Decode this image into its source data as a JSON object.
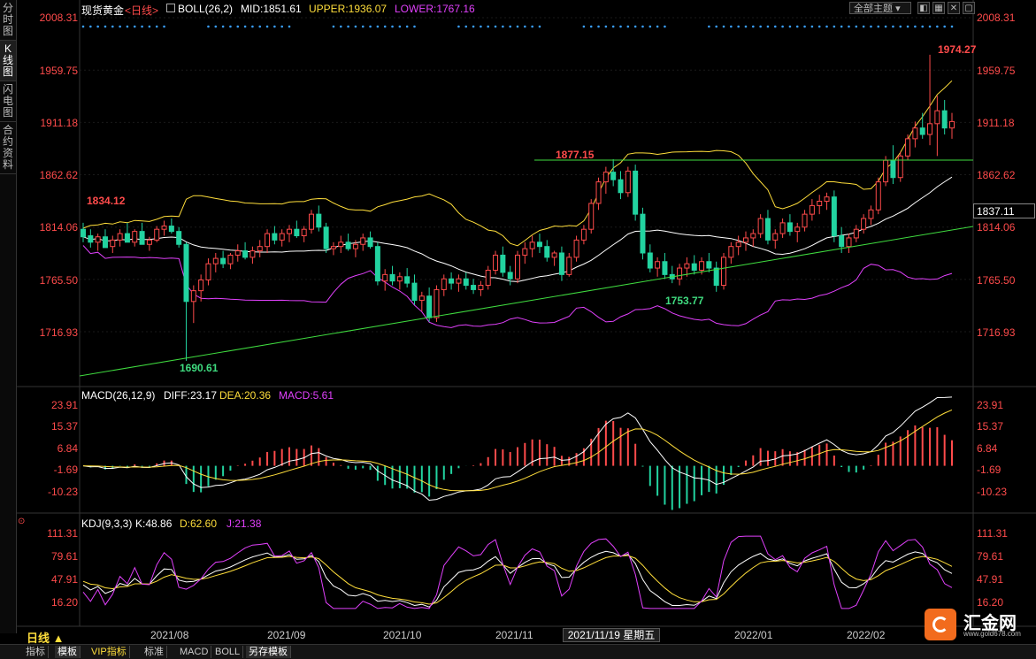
{
  "left_rail": [
    {
      "label": "分时图",
      "active": false
    },
    {
      "label": "K线图",
      "active": true
    },
    {
      "label": "闪电图",
      "active": false
    },
    {
      "label": "合约资料",
      "active": false
    }
  ],
  "header": {
    "symbol": "现货黄金",
    "period": "<日线>",
    "boll_label": "BOLL(26,2)",
    "mid": "MID:1851.61",
    "upper": "UPPER:1936.07",
    "lower": "LOWER:1767.16",
    "theme_select": "全部主题",
    "colors": {
      "symbol": "#ffffff",
      "period": "#ff4b4b",
      "mid": "#ffffff",
      "upper": "#ffde3b",
      "lower": "#e040fb"
    }
  },
  "price_axis": {
    "labels": [
      "2008.31",
      "1959.75",
      "1911.18",
      "1862.62",
      "1814.06",
      "1765.50",
      "1716.93"
    ],
    "current_price": "1837.11"
  },
  "annotations": {
    "high": "1974.27",
    "nov_high": "1877.15",
    "early_level": "1834.12",
    "low": "1690.61",
    "nov_low": "1753.77"
  },
  "macd": {
    "label": "MACD(26,12,9)",
    "diff": "DIFF:23.17",
    "dea": "DEA:20.36",
    "macd": "MACD:5.61",
    "axis": [
      "23.91",
      "15.37",
      "6.84",
      "-1.69",
      "-10.23"
    ]
  },
  "kdj": {
    "label": "KDJ(9,3,3)",
    "k": "K:48.86",
    "d": "D:62.60",
    "j": "J:21.38",
    "axis": [
      "111.31",
      "79.61",
      "47.91",
      "16.20"
    ]
  },
  "dates": [
    "2021/08",
    "2021/09",
    "2021/10",
    "2021/11",
    "2022/01",
    "2022/02"
  ],
  "crosshair_date": "2021/11/19 星期五",
  "period_button": "日线 ▲",
  "bottom_tabs": [
    {
      "label": "指标",
      "active": false
    },
    {
      "label": "模板",
      "active": true
    },
    {
      "label": "VIP指标",
      "active": false
    },
    {
      "label": "标准",
      "active": false
    },
    {
      "label": "MACD",
      "active": false
    },
    {
      "label": "BOLL",
      "active": false
    },
    {
      "label": "另存模板",
      "active": false
    }
  ],
  "logo": {
    "name": "汇金网",
    "url": "www.gold678.com"
  },
  "window_buttons": [
    "◧",
    "▦",
    "✕",
    "▢"
  ],
  "chart_data": {
    "type": "candlestick",
    "series_daily": [
      [
        1812,
        1818,
        1800,
        1805
      ],
      [
        1806,
        1812,
        1795,
        1800
      ],
      [
        1800,
        1808,
        1792,
        1805
      ],
      [
        1805,
        1812,
        1798,
        1795
      ],
      [
        1796,
        1806,
        1790,
        1802
      ],
      [
        1802,
        1812,
        1796,
        1808
      ],
      [
        1808,
        1818,
        1802,
        1800
      ],
      [
        1800,
        1812,
        1796,
        1810
      ],
      [
        1810,
        1818,
        1804,
        1798
      ],
      [
        1798,
        1805,
        1792,
        1802
      ],
      [
        1802,
        1815,
        1800,
        1812
      ],
      [
        1812,
        1820,
        1806,
        1815
      ],
      [
        1815,
        1822,
        1808,
        1810
      ],
      [
        1810,
        1814,
        1795,
        1798
      ],
      [
        1798,
        1800,
        1690,
        1745
      ],
      [
        1745,
        1760,
        1725,
        1755
      ],
      [
        1755,
        1770,
        1745,
        1765
      ],
      [
        1765,
        1785,
        1760,
        1780
      ],
      [
        1780,
        1790,
        1772,
        1785
      ],
      [
        1785,
        1792,
        1776,
        1780
      ],
      [
        1780,
        1790,
        1775,
        1788
      ],
      [
        1788,
        1798,
        1782,
        1792
      ],
      [
        1792,
        1800,
        1784,
        1786
      ],
      [
        1786,
        1796,
        1780,
        1792
      ],
      [
        1792,
        1802,
        1786,
        1796
      ],
      [
        1796,
        1812,
        1790,
        1808
      ],
      [
        1808,
        1815,
        1798,
        1802
      ],
      [
        1802,
        1812,
        1796,
        1808
      ],
      [
        1808,
        1816,
        1800,
        1812
      ],
      [
        1812,
        1820,
        1804,
        1806
      ],
      [
        1806,
        1815,
        1800,
        1812
      ],
      [
        1812,
        1830,
        1808,
        1826
      ],
      [
        1826,
        1834,
        1810,
        1814
      ],
      [
        1814,
        1818,
        1790,
        1794
      ],
      [
        1794,
        1800,
        1788,
        1796
      ],
      [
        1796,
        1806,
        1790,
        1800
      ],
      [
        1800,
        1808,
        1792,
        1794
      ],
      [
        1794,
        1802,
        1786,
        1798
      ],
      [
        1798,
        1808,
        1792,
        1804
      ],
      [
        1804,
        1810,
        1794,
        1796
      ],
      [
        1796,
        1800,
        1760,
        1764
      ],
      [
        1764,
        1775,
        1755,
        1770
      ],
      [
        1770,
        1778,
        1760,
        1764
      ],
      [
        1764,
        1772,
        1756,
        1768
      ],
      [
        1768,
        1776,
        1758,
        1762
      ],
      [
        1762,
        1770,
        1742,
        1746
      ],
      [
        1746,
        1754,
        1736,
        1750
      ],
      [
        1750,
        1758,
        1726,
        1730
      ],
      [
        1730,
        1760,
        1726,
        1756
      ],
      [
        1756,
        1770,
        1750,
        1766
      ],
      [
        1766,
        1772,
        1756,
        1762
      ],
      [
        1762,
        1770,
        1754,
        1766
      ],
      [
        1766,
        1772,
        1756,
        1760
      ],
      [
        1760,
        1766,
        1752,
        1756
      ],
      [
        1756,
        1764,
        1750,
        1760
      ],
      [
        1760,
        1778,
        1756,
        1774
      ],
      [
        1774,
        1792,
        1770,
        1788
      ],
      [
        1788,
        1796,
        1768,
        1772
      ],
      [
        1772,
        1778,
        1760,
        1766
      ],
      [
        1766,
        1792,
        1762,
        1788
      ],
      [
        1788,
        1800,
        1780,
        1794
      ],
      [
        1794,
        1806,
        1786,
        1800
      ],
      [
        1800,
        1808,
        1790,
        1796
      ],
      [
        1796,
        1802,
        1782,
        1786
      ],
      [
        1786,
        1792,
        1778,
        1790
      ],
      [
        1790,
        1796,
        1764,
        1770
      ],
      [
        1770,
        1790,
        1768,
        1786
      ],
      [
        1786,
        1806,
        1782,
        1802
      ],
      [
        1802,
        1816,
        1798,
        1812
      ],
      [
        1812,
        1840,
        1808,
        1836
      ],
      [
        1836,
        1860,
        1830,
        1856
      ],
      [
        1856,
        1870,
        1845,
        1865
      ],
      [
        1865,
        1877,
        1852,
        1858
      ],
      [
        1858,
        1866,
        1840,
        1846
      ],
      [
        1846,
        1870,
        1842,
        1866
      ],
      [
        1866,
        1872,
        1820,
        1826
      ],
      [
        1826,
        1832,
        1784,
        1790
      ],
      [
        1790,
        1798,
        1772,
        1776
      ],
      [
        1776,
        1786,
        1768,
        1782
      ],
      [
        1782,
        1790,
        1766,
        1770
      ],
      [
        1770,
        1778,
        1762,
        1766
      ],
      [
        1766,
        1780,
        1760,
        1776
      ],
      [
        1776,
        1786,
        1768,
        1780
      ],
      [
        1780,
        1788,
        1770,
        1774
      ],
      [
        1774,
        1786,
        1770,
        1782
      ],
      [
        1782,
        1790,
        1772,
        1776
      ],
      [
        1776,
        1782,
        1754,
        1760
      ],
      [
        1760,
        1790,
        1756,
        1786
      ],
      [
        1786,
        1800,
        1780,
        1796
      ],
      [
        1796,
        1806,
        1788,
        1800
      ],
      [
        1800,
        1810,
        1792,
        1804
      ],
      [
        1804,
        1812,
        1796,
        1808
      ],
      [
        1808,
        1826,
        1804,
        1822
      ],
      [
        1822,
        1830,
        1798,
        1802
      ],
      [
        1802,
        1812,
        1794,
        1808
      ],
      [
        1808,
        1822,
        1804,
        1818
      ],
      [
        1818,
        1826,
        1806,
        1810
      ],
      [
        1810,
        1818,
        1800,
        1814
      ],
      [
        1814,
        1830,
        1810,
        1826
      ],
      [
        1826,
        1840,
        1820,
        1834
      ],
      [
        1834,
        1844,
        1826,
        1838
      ],
      [
        1838,
        1846,
        1830,
        1842
      ],
      [
        1842,
        1848,
        1800,
        1806
      ],
      [
        1806,
        1814,
        1790,
        1796
      ],
      [
        1796,
        1808,
        1790,
        1804
      ],
      [
        1804,
        1816,
        1800,
        1812
      ],
      [
        1812,
        1826,
        1808,
        1822
      ],
      [
        1822,
        1834,
        1816,
        1830
      ],
      [
        1830,
        1860,
        1826,
        1856
      ],
      [
        1856,
        1880,
        1852,
        1876
      ],
      [
        1876,
        1890,
        1854,
        1860
      ],
      [
        1860,
        1884,
        1856,
        1880
      ],
      [
        1880,
        1900,
        1876,
        1896
      ],
      [
        1896,
        1912,
        1888,
        1906
      ],
      [
        1906,
        1920,
        1896,
        1900
      ],
      [
        1900,
        1974,
        1890,
        1910
      ],
      [
        1910,
        1936,
        1880,
        1922
      ],
      [
        1922,
        1932,
        1900,
        1906
      ],
      [
        1906,
        1920,
        1896,
        1912
      ]
    ]
  }
}
